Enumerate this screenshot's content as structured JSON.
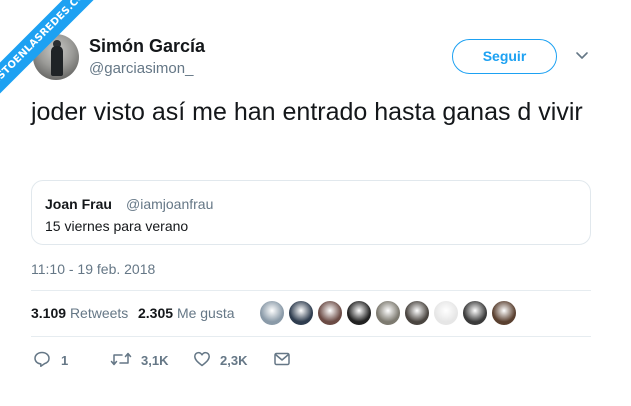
{
  "watermark": "VISTOENLASREDES.COM",
  "author": {
    "name": "Simón García",
    "handle": "@garciasimon_"
  },
  "follow_label": "Seguir",
  "tweet_text": "joder visto así me han entrado hasta ganas d vivir",
  "quoted": {
    "name": "Joan Frau",
    "handle": "@iamjoanfrau",
    "text": "15 viernes para verano"
  },
  "timestamp": "11:10 - 19 feb. 2018",
  "stats": {
    "retweets_count": "3.109",
    "retweets_label": "Retweets",
    "likes_count": "2.305",
    "likes_label": "Me gusta"
  },
  "likers": [
    "#8a9aa8",
    "#2f3d4f",
    "#6b4b45",
    "#222222",
    "#7d7a70",
    "#4a4540",
    "#e6e6e6",
    "#3b3b3b",
    "#5a4030"
  ],
  "actions": {
    "replies": "1",
    "retweets": "3,1K",
    "likes": "2,3K"
  },
  "colors": {
    "accent": "#1da1f2",
    "muted": "#657786",
    "text": "#14171a",
    "border": "#e1e8ed"
  }
}
